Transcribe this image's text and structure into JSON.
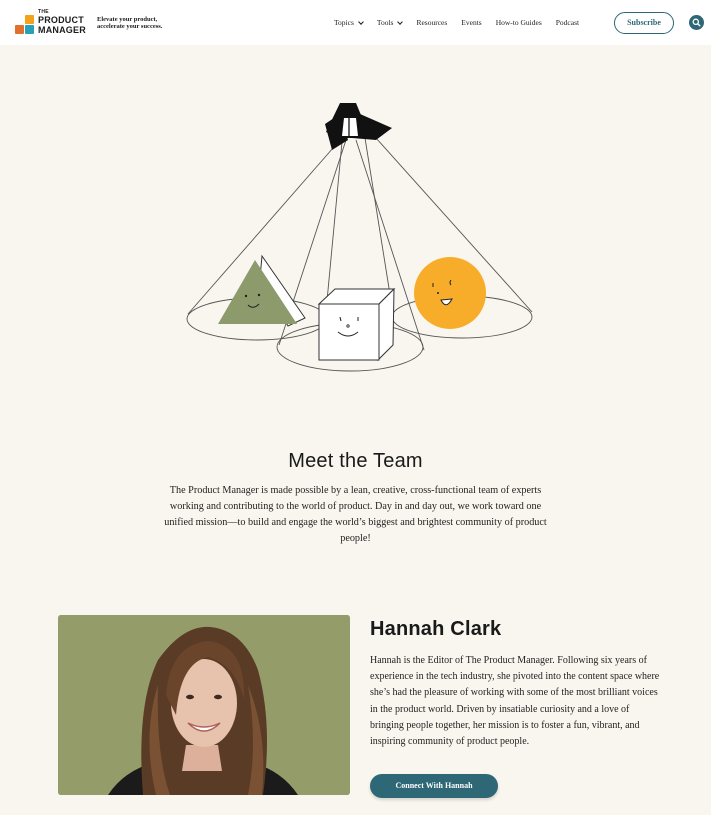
{
  "header": {
    "logo_the": "THE",
    "logo_line1": "PRODUCT",
    "logo_line2": "MANAGER",
    "tagline_line1": "Elevate your product,",
    "tagline_line2": "accelerate your success.",
    "nav": [
      {
        "label": "Topics",
        "has_dropdown": true
      },
      {
        "label": "Tools",
        "has_dropdown": true
      },
      {
        "label": "Resources",
        "has_dropdown": false
      },
      {
        "label": "Events",
        "has_dropdown": false
      },
      {
        "label": "How-to Guides",
        "has_dropdown": false
      },
      {
        "label": "Podcast",
        "has_dropdown": false
      }
    ],
    "subscribe_label": "Subscribe",
    "search_icon": "search-icon"
  },
  "team": {
    "title": "Meet the Team",
    "intro": "The Product Manager is made possible by a lean, creative, cross-functional team of experts working and contributing to the world of product. Day in and day out, we work toward one unified mission—to build and engage the world’s biggest and brightest community of product people!"
  },
  "profile": {
    "name": "Hannah Clark",
    "bio": "Hannah is the Editor of The Product Manager. Following six years of experience in the tech industry, she pivoted into the content space where she’s had the pleasure of working with some of the most brilliant voices in the product world. Driven by insatiable curiosity and a love of bringing people together, her mission is to foster a fun, vibrant, and inspiring community of product people.",
    "connect_label": "Connect With Hannah"
  },
  "colors": {
    "accent": "#2e6775",
    "background": "#f9f6f0",
    "photo_bg": "#949d6a",
    "triangle": "#8c9a6c",
    "circle": "#f7ad2a"
  }
}
